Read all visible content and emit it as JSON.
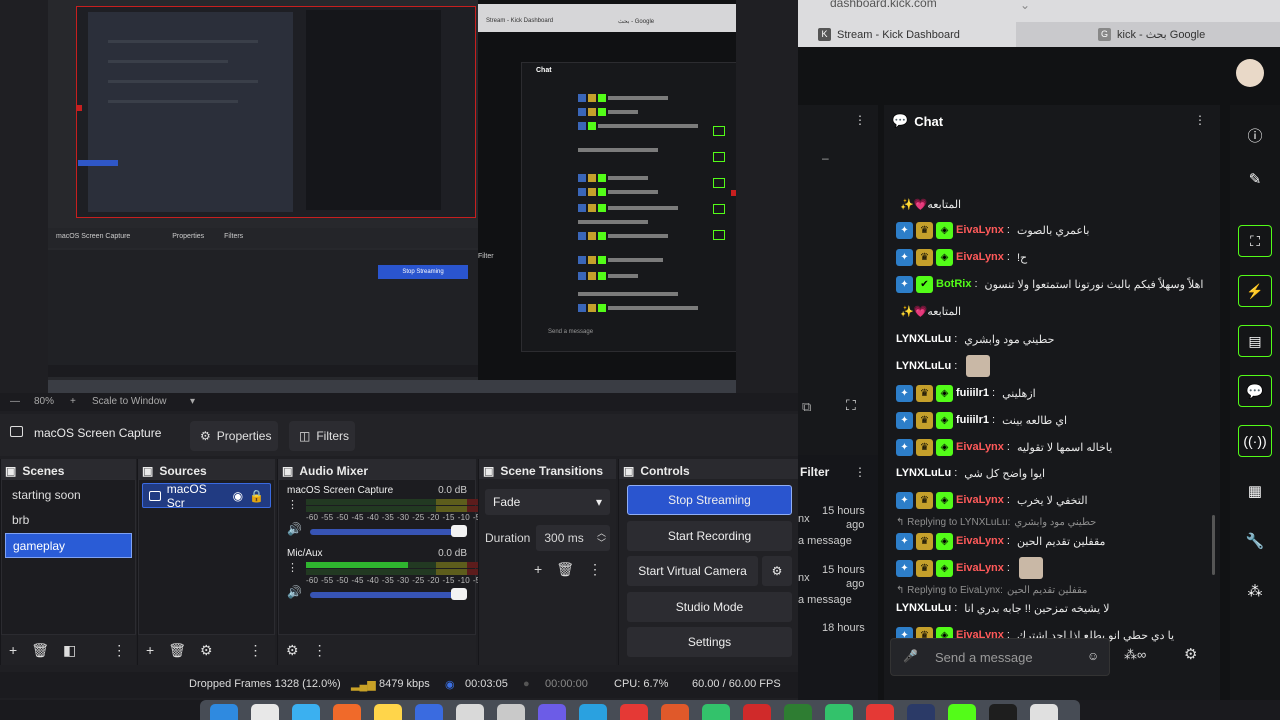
{
  "preview": {
    "mini_chat_title": "Chat",
    "mini_send_placeholder": "Send a message",
    "mini_filter": "Filter",
    "mini_tabs": [
      "Stream - Kick Dashboard",
      "بحث - Google"
    ]
  },
  "zoom": {
    "value": "80%",
    "scale_label": "Scale to Window"
  },
  "source_toolbar": {
    "source_name": "macOS Screen Capture",
    "properties_label": "Properties",
    "filters_label": "Filters"
  },
  "scenes": {
    "title": "Scenes",
    "items": [
      "starting soon",
      "brb",
      "gameplay"
    ],
    "selected_index": 2
  },
  "sources": {
    "title": "Sources",
    "items": [
      "macOS Scr"
    ]
  },
  "audio_mixer": {
    "title": "Audio Mixer",
    "tick_labels": [
      "-60",
      "-55",
      "-50",
      "-45",
      "-40",
      "-35",
      "-30",
      "-25",
      "-20",
      "-15",
      "-10",
      "-5",
      "0"
    ],
    "channels": [
      {
        "name": "macOS Screen Capture",
        "db": "0.0 dB",
        "level": 0.0
      },
      {
        "name": "Mic/Aux",
        "db": "0.0 dB",
        "level": 0.55
      }
    ]
  },
  "transitions": {
    "title": "Scene Transitions",
    "selected": "Fade",
    "duration_label": "Duration",
    "duration_value": "300 ms"
  },
  "controls": {
    "title": "Controls",
    "stop_streaming": "Stop Streaming",
    "start_recording": "Start Recording",
    "start_virtual_camera": "Start Virtual Camera",
    "studio_mode": "Studio Mode",
    "settings": "Settings"
  },
  "status": {
    "dropped_frames": "Dropped Frames 1328 (12.0%)",
    "bitrate": "8479 kbps",
    "stream_time": "00:03:05",
    "record_time": "00:00:00",
    "cpu": "CPU: 6.7%",
    "fps": "60.00 / 60.00 FPS"
  },
  "browser": {
    "url_partial": "dashboard.kick.com",
    "tabs": [
      "Stream - Kick Dashboard",
      "kick - بحث Google"
    ]
  },
  "left_panel": {
    "filter_label": "Filter",
    "items": [
      {
        "label": "nx",
        "time": "15 hours",
        "ago": "ago",
        "msg": "a message"
      },
      {
        "label": "nx",
        "time": "15 hours",
        "ago": "ago",
        "msg": "a message"
      },
      {
        "label": "",
        "time": "18 hours",
        "ago": "",
        "msg": ""
      }
    ]
  },
  "chat": {
    "title": "Chat",
    "top_text": "المتابعه💗✨",
    "messages": [
      {
        "user": "EivaLynx",
        "color": "#ff5a5a",
        "badges": 3,
        "text": "باعمري بالصوت"
      },
      {
        "user": "EivaLynx",
        "color": "#ff5a5a",
        "badges": 3,
        "text": "ح!"
      },
      {
        "user": "BotRix",
        "color": "#53fc18",
        "badges": 2,
        "text": "اهلاً وسهلاً فيكم بالبث نورتونا استمتعوا ولا تنسون"
      },
      {
        "user": "",
        "color": "",
        "badges": 0,
        "text": "المتابعه💗✨"
      },
      {
        "user": "LYNXLuLu",
        "color": "#ffffff",
        "badges": 0,
        "text": "حطيني مود وابشري"
      },
      {
        "user": "LYNXLuLu",
        "color": "#ffffff",
        "badges": 0,
        "text": ""
      },
      {
        "user": "fuiiilr1",
        "color": "#ffffff",
        "badges": 3,
        "text": "ازهليني"
      },
      {
        "user": "fuiiilr1",
        "color": "#ffffff",
        "badges": 3,
        "text": "اي طالعه بينت"
      },
      {
        "user": "EivaLynx",
        "color": "#ff5a5a",
        "badges": 3,
        "text": "ياخاله اسمها لا تقوليه"
      },
      {
        "user": "LYNXLuLu",
        "color": "#ffffff",
        "badges": 0,
        "text": "ايوا واضح كل شي"
      },
      {
        "user": "EivaLynx",
        "color": "#ff5a5a",
        "badges": 3,
        "text": "التخفي لا يخرب"
      },
      {
        "user": "EivaLynx",
        "color": "#ff5a5a",
        "badges": 3,
        "text": "مقفلين تقديم الحين"
      },
      {
        "user": "EivaLynx",
        "color": "#ff5a5a",
        "badges": 3,
        "text": ""
      },
      {
        "user": "LYNXLuLu",
        "color": "#ffffff",
        "badges": 0,
        "text": "لا يشيخه تمزحين !! جابه بدري انا"
      },
      {
        "user": "EivaLynx",
        "color": "#ff5a5a",
        "badges": 3,
        "text": "يا دي حطي انو بطلع اذا احد اشترك"
      }
    ],
    "replies": [
      {
        "to": "Replying to LYNXLuLu:",
        "quote": "حطيني مود وابشري"
      },
      {
        "to": "Replying to EivaLynx:",
        "quote": "مقفلين تقديم الحين"
      }
    ],
    "send_placeholder": "Send a message"
  },
  "colors": {
    "kick_green": "#53fc18",
    "obs_blue": "#2a55cf",
    "rec_red": "#c71f1f"
  }
}
